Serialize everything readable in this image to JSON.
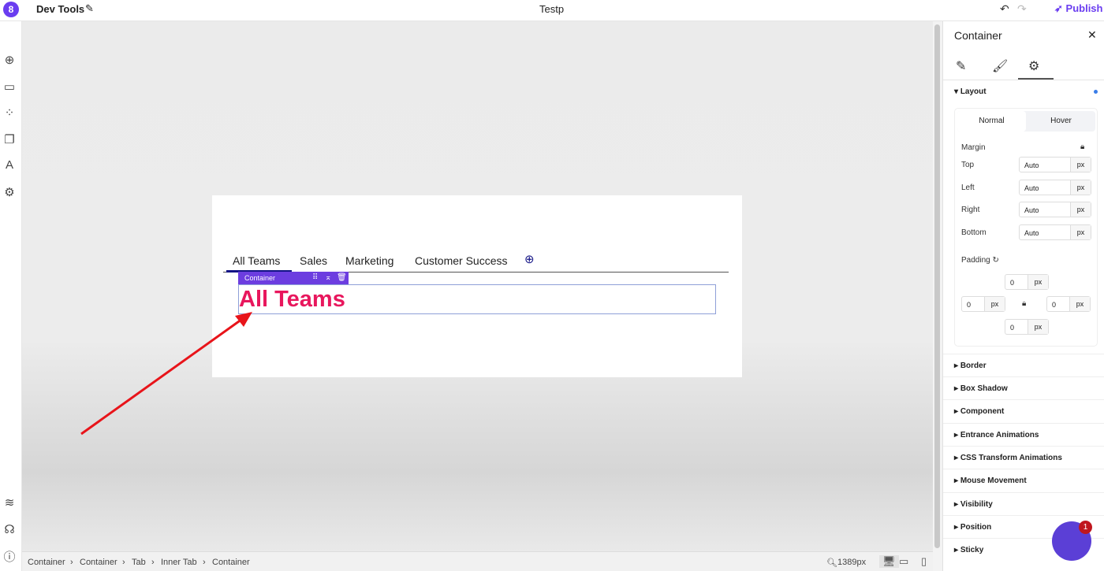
{
  "topbar": {
    "app_title": "Dev Tools",
    "page_title": "Testp",
    "publish_label": "Publish",
    "logo_text": "8"
  },
  "canvas": {
    "tabs": [
      "All Teams",
      "Sales",
      "Marketing",
      "Customer Success"
    ],
    "container_tag": "Container",
    "heading": "All Teams"
  },
  "breadcrumb": [
    "Container",
    "Container",
    "Tab",
    "Inner Tab",
    "Container"
  ],
  "zoom": "1389px",
  "panel": {
    "title": "Container",
    "layout_label": "Layout",
    "state_tabs": [
      "Normal",
      "Hover"
    ],
    "margin_label": "Margin",
    "margin": [
      {
        "label": "Top",
        "value": "Auto",
        "unit": "px"
      },
      {
        "label": "Left",
        "value": "Auto",
        "unit": "px"
      },
      {
        "label": "Right",
        "value": "Auto",
        "unit": "px"
      },
      {
        "label": "Bottom",
        "value": "Auto",
        "unit": "px"
      }
    ],
    "padding_label": "Padding",
    "padding": {
      "top": "0",
      "left": "0",
      "right": "0",
      "bottom": "0",
      "unit": "px"
    },
    "sections": [
      "Border",
      "Box Shadow",
      "Component",
      "Entrance Animations",
      "CSS Transform Animations",
      "Mouse Movement",
      "Visibility",
      "Position",
      "Sticky"
    ]
  },
  "chat": {
    "badge": "1"
  },
  "colors": {
    "accent": "#6a3df0",
    "heading": "#e8175d",
    "tab_underline": "#141486"
  }
}
